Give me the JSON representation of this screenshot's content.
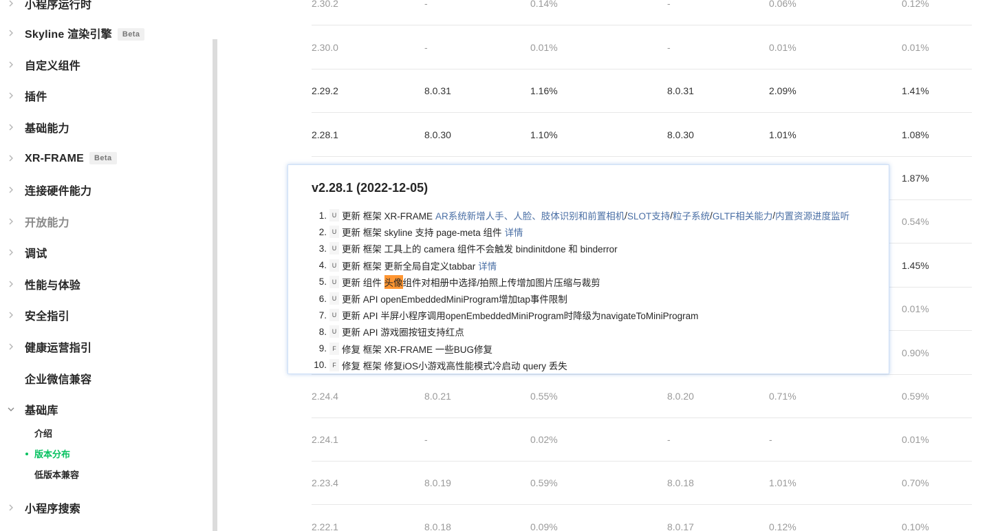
{
  "sidebar": {
    "top_item_cropped": "小程序运行时",
    "items": [
      {
        "label": "Skyline 渲染引擎",
        "badge": "Beta"
      },
      {
        "label": "自定义组件"
      },
      {
        "label": "插件"
      },
      {
        "label": "基础能力"
      },
      {
        "label": "XR-FRAME",
        "badge": "Beta"
      },
      {
        "label": "连接硬件能力"
      },
      {
        "label": "开放能力"
      },
      {
        "label": "调试"
      },
      {
        "label": "性能与体验"
      },
      {
        "label": "安全指引"
      },
      {
        "label": "健康运营指引"
      },
      {
        "label": "企业微信兼容"
      },
      {
        "label": "基础库"
      },
      {
        "label": "小程序搜索"
      }
    ],
    "sub_items": [
      {
        "label": "介绍"
      },
      {
        "label": "版本分布",
        "active": true
      },
      {
        "label": "低版本兼容"
      }
    ]
  },
  "table": {
    "rows": [
      [
        "2.30.2",
        "-",
        "0.14%",
        "-",
        "0.06%",
        "0.12%"
      ],
      [
        "2.30.0",
        "-",
        "0.01%",
        "-",
        "0.01%",
        "0.01%"
      ],
      [
        "2.29.2",
        "8.0.31",
        "1.16%",
        "8.0.31",
        "2.09%",
        "1.41%"
      ],
      [
        "2.28.1",
        "8.0.30",
        "1.10%",
        "8.0.30",
        "1.01%",
        "1.08%"
      ],
      [
        "",
        "",
        "",
        "",
        "",
        "1.87%"
      ],
      [
        "",
        "",
        "",
        "",
        "",
        "0.54%"
      ],
      [
        "",
        "",
        "",
        "",
        "",
        "1.45%"
      ],
      [
        "",
        "",
        "",
        "",
        "",
        "0.01%"
      ],
      [
        "",
        "",
        "",
        "",
        "",
        "0.90%"
      ],
      [
        "2.24.4",
        "8.0.21",
        "0.55%",
        "8.0.20",
        "0.71%",
        "0.59%"
      ],
      [
        "2.24.1",
        "-",
        "0.02%",
        "-",
        "-",
        "0.01%"
      ],
      [
        "2.23.4",
        "8.0.19",
        "0.59%",
        "8.0.18",
        "1.01%",
        "0.70%"
      ],
      [
        "2.22.1",
        "8.0.18",
        "0.09%",
        "8.0.17",
        "0.12%",
        "0.10%"
      ]
    ]
  },
  "popup": {
    "title": "v2.28.1 (2022-12-05)",
    "items": [
      {
        "num": "1.",
        "tag": "U",
        "text": "更新 框架 XR-FRAME",
        "links": [
          "AR系统新增人手、人脸、肢体识别和前置相机",
          "/",
          "SLOT支持",
          "/",
          "粒子系统",
          "/",
          "GLTF相关能力",
          "/",
          "内置资源进度监听"
        ]
      },
      {
        "num": "2.",
        "tag": "U",
        "text": "更新 框架 skyline 支持 page-meta 组件",
        "link": "详情"
      },
      {
        "num": "3.",
        "tag": "U",
        "text": "更新 框架 工具上的 camera 组件不会触发 bindinitdone 和 binderror"
      },
      {
        "num": "4.",
        "tag": "U",
        "text": "更新 框架 更新全局自定义tabbar",
        "link": "详情"
      },
      {
        "num": "5.",
        "tag": "U",
        "text_before": "更新 组件 ",
        "highlight": "头像",
        "text_after": "组件对相册中选择/拍照上传增加图片压缩与裁剪"
      },
      {
        "num": "6.",
        "tag": "U",
        "text": "更新 API openEmbeddedMiniProgram增加tap事件限制"
      },
      {
        "num": "7.",
        "tag": "U",
        "text": "更新 API 半屏小程序调用openEmbeddedMiniProgram时降级为navigateToMiniProgram"
      },
      {
        "num": "8.",
        "tag": "U",
        "text": "更新 API 游戏圈按钮支持红点"
      },
      {
        "num": "9.",
        "tag": "F",
        "text": "修复 框架 XR-FRAME 一些BUG修复"
      },
      {
        "num": "10.",
        "tag": "F",
        "text": "修复 框架 修复iOS小游戏高性能模式冷启动 query 丢失"
      }
    ]
  }
}
